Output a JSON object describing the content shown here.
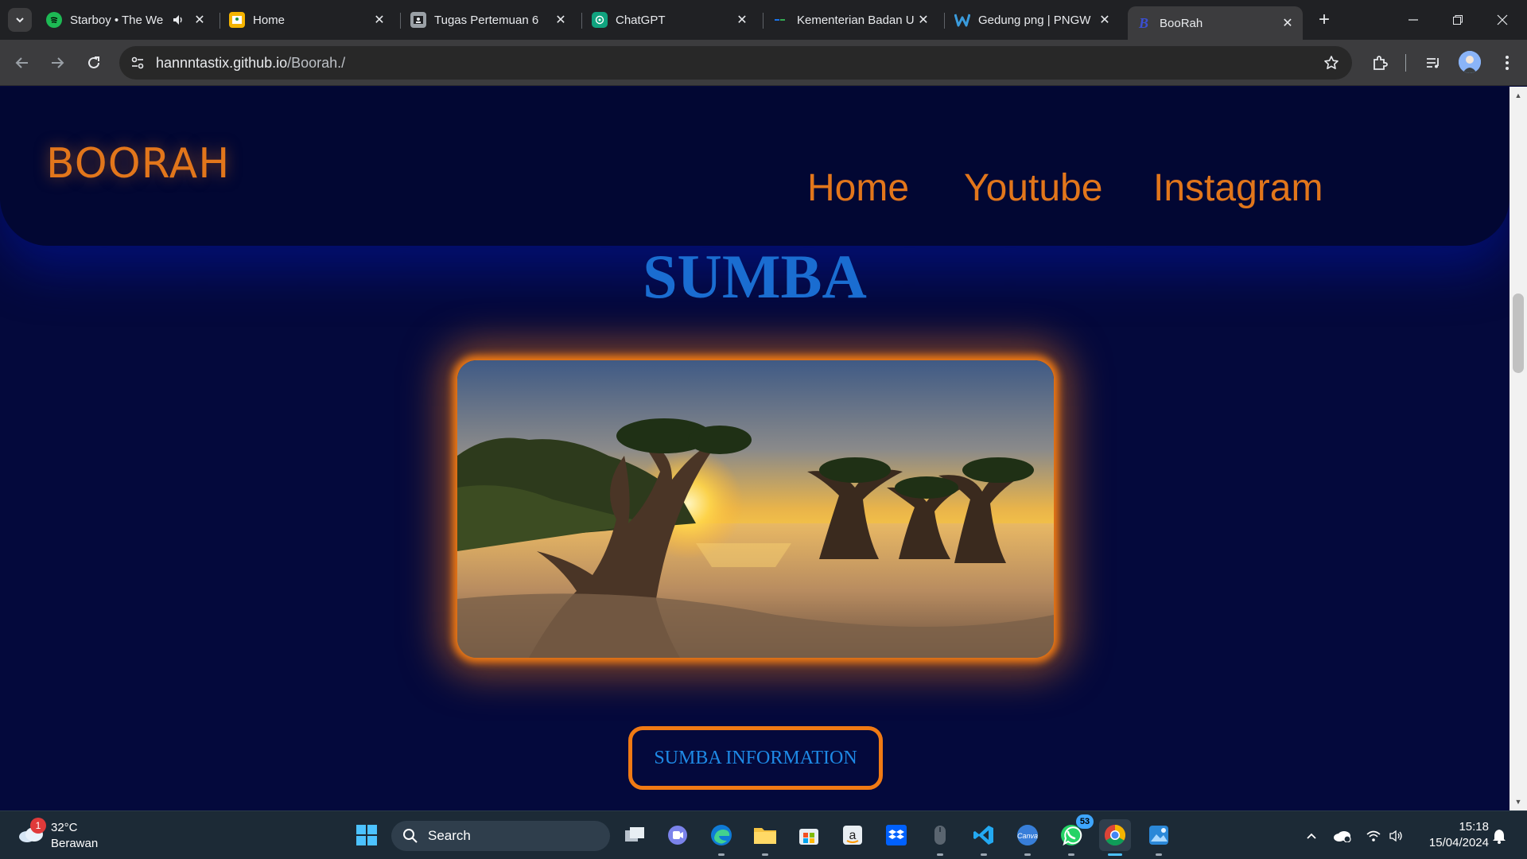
{
  "browser": {
    "tabs": [
      {
        "title": "Starboy • The We",
        "favicon": "spotify-icon",
        "favicon_color": "#1db954",
        "audio": true
      },
      {
        "title": "Home",
        "favicon": "classroom-icon",
        "favicon_color": "#f4b400"
      },
      {
        "title": "Tugas Pertemuan 6",
        "favicon": "assignment-icon",
        "favicon_color": "#9aa0a6"
      },
      {
        "title": "ChatGPT",
        "favicon": "chatgpt-icon",
        "favicon_color": "#10a37f"
      },
      {
        "title": "Kementerian Badan U",
        "favicon": "ministry-icon",
        "favicon_color": "#1a73e8"
      },
      {
        "title": "Gedung png | PNGW",
        "favicon": "pngwing-icon",
        "favicon_color": "#3a9bdc"
      },
      {
        "title": "BooRah",
        "favicon": "boorah-icon",
        "favicon_color": "#3b4fd1",
        "active": true
      }
    ],
    "address": {
      "host": "hannntastix.github.io",
      "path": "/Boorah./"
    }
  },
  "page": {
    "logo": "BOORAH",
    "nav": [
      "Home",
      "Youtube",
      "Instagram"
    ],
    "title": "SUMBA",
    "button": "SUMBA INFORMATION",
    "colors": {
      "accent": "#e2761b",
      "title_blue": "#1a6dd1",
      "background": "#04093c"
    }
  },
  "taskbar": {
    "weather": {
      "badge": "1",
      "temp": "32°C",
      "condition": "Berawan"
    },
    "search_label": "Search",
    "whatsapp_badge": "53",
    "clock": {
      "time": "15:18",
      "date": "15/04/2024"
    }
  }
}
